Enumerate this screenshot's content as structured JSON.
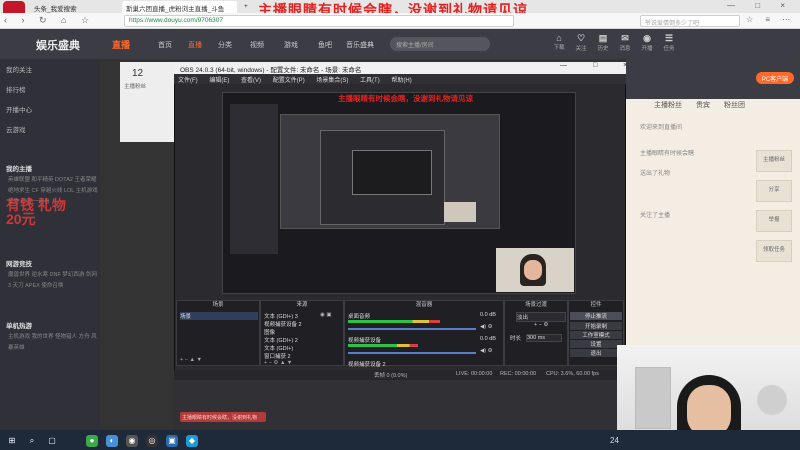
{
  "browser": {
    "tabs": [
      {
        "label": "头条_我爱搜索"
      },
      {
        "label": "斯巢六团直播_虎粉浏主直播_斗鱼"
      },
      {
        "label": "+"
      }
    ],
    "banner_text": "主播眼睛有时候会瞎，没谢到礼物请见谅",
    "window_controls": "— □ ×",
    "nav_icons": "‹ › ↻ ⌂ ☆",
    "url": "https://www.douyu.com/9706307",
    "search_placeholder": "爷说爱情倒多少了吧",
    "nav_right_icons": "☆ ≡ ⋯"
  },
  "site": {
    "logo": "娱乐盛典",
    "logo_badge": "直播",
    "nav": [
      "首页",
      "直播",
      "分类",
      "视频",
      "游戏",
      "鱼吧",
      "音乐盛典"
    ],
    "search_placeholder": "搜索主播/房间",
    "header_icons": [
      {
        "glyph": "⌂",
        "label": "下载"
      },
      {
        "glyph": "♡",
        "label": "关注"
      },
      {
        "glyph": "▤",
        "label": "历史"
      },
      {
        "glyph": "✉",
        "label": "消息"
      },
      {
        "glyph": "◉",
        "label": "开播"
      },
      {
        "glyph": "☰",
        "label": "任务"
      }
    ]
  },
  "sidebar": {
    "items": [
      "我的关注",
      "排行榜",
      "开播中心",
      "云游戏"
    ],
    "section1_title": "我的主播",
    "section1_grid": "英雄联盟 和平精英 DOTA2 王者荣耀 绝地求生 CF 穿越火线 LOL 主机游戏 星秀 颜值 一起看",
    "section2_title": "网游竞技",
    "section2_grid": "魔兽世界 逆水寒 DNF 梦幻西游 剑网3 天刀 APEX 使命召唤",
    "section3_title": "单机热游",
    "section3_grid": "主机游戏 我的世界 怪物猎人 方舟 风暴英雄",
    "watermark": "有钱 礼物 20元"
  },
  "room": {
    "number": "12",
    "subtitle": "主播粉丝"
  },
  "obs": {
    "title": "OBS 24.0.3 (64-bit, windows) - 配置文件: 未命名 - 场景: 未命名",
    "title_controls": "— □ ×",
    "menu": [
      "文件(F)",
      "编辑(E)",
      "查看(V)",
      "配置文件(P)",
      "场景集合(S)",
      "工具(T)",
      "帮助(H)"
    ],
    "preview_banner": "主播眼睛有时候会瞎，没谢到礼物请见谅",
    "docks": {
      "scenes": {
        "title": "场景",
        "items": [
          "场景"
        ]
      },
      "sources": {
        "title": "来源",
        "items": [
          "文本 (GDI+) 3",
          "视频捕获设备 2",
          "图像",
          "文本 (GDI+) 2",
          "文本 (GDI+)",
          "窗口捕获 2"
        ]
      },
      "mixer": {
        "title": "混音器",
        "channels": [
          {
            "name": "桌面音频",
            "value": "0.0 dB",
            "level": 0.72
          },
          {
            "name": "视频捕获设备",
            "value": "0.0 dB",
            "level": 0.55
          },
          {
            "name": "视频捕获设备 2",
            "value": "0.0 dB",
            "level": 0.3
          }
        ]
      },
      "transitions": {
        "title": "场景过渡",
        "type": "淡出",
        "duration_label": "时长",
        "duration": "300 ms"
      },
      "controls": {
        "title": "控件",
        "buttons": [
          "停止推流",
          "开始录制",
          "工作室模式",
          "设置",
          "退出"
        ]
      }
    },
    "status": {
      "live": "LIVE: 00:00:00",
      "rec": "REC: 00:00:00",
      "cpu": "CPU: 3.6%, 60.00 fps",
      "dropped": "丢帧 0 (0.0%)"
    },
    "chat_bubble": "主播眼睛有时候会瞎，没谢到礼物"
  },
  "chat": {
    "header": "PC客户端",
    "tabs": [
      "主播粉丝",
      "贵宾",
      "粉丝团"
    ],
    "lines": [
      "欢迎来到直播间",
      "主播眼睛有时候会瞎",
      "送出了礼物",
      "关注了主播"
    ],
    "side_buttons": [
      "主播粉丝",
      "分享",
      "举报",
      "领取任务"
    ]
  },
  "taskbar": {
    "icons": [
      "⊞",
      "⌕",
      "▢",
      "●",
      "◐",
      "◉",
      "◎",
      "▣",
      "◆"
    ],
    "clock": "24"
  },
  "colors": {
    "banner_red": "#e32222",
    "obs_dark": "#2a2a2f",
    "meter_green": "#2ec24a",
    "site_header": "#3c3d44"
  }
}
